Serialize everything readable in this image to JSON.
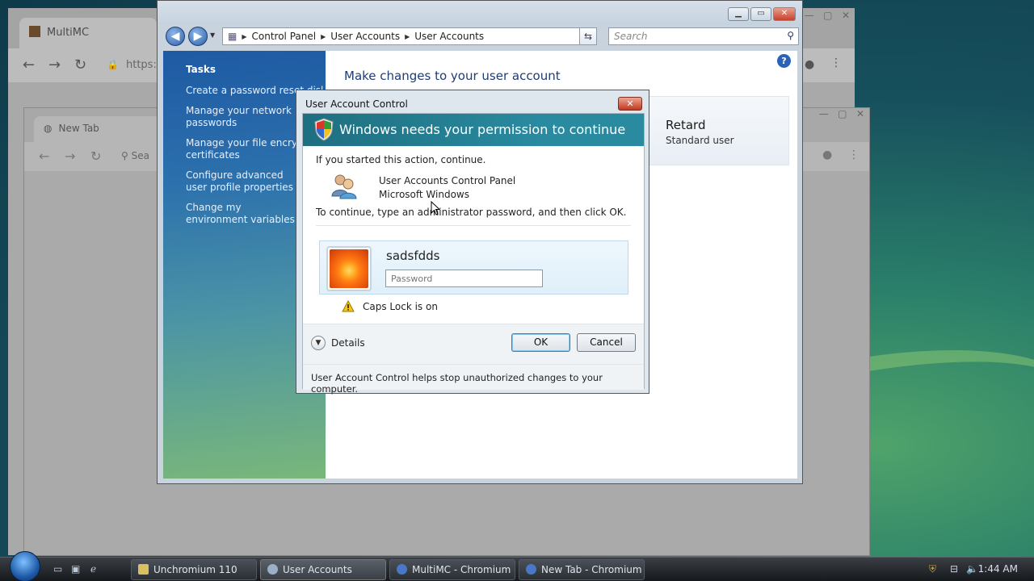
{
  "bg_window_1": {
    "tab_title": "MultiMC",
    "url_text": "https:/"
  },
  "bg_window_2": {
    "tab_title": "New Tab",
    "search_placeholder": "Sea"
  },
  "control_panel": {
    "breadcrumb": [
      "Control Panel",
      "User Accounts",
      "User Accounts"
    ],
    "search_placeholder": "Search",
    "tasks_heading": "Tasks",
    "tasks": [
      "Create a password reset disk",
      "Manage your network passwords",
      "Manage your file encryption certificates",
      "Configure advanced user profile properties",
      "Change my environment variables"
    ],
    "main_title": "Make changes to your user account",
    "user_name": "Retard",
    "user_role": "Standard user"
  },
  "uac": {
    "window_title": "User Account Control",
    "banner": "Windows needs your permission to continue",
    "intro": "If you started this action, continue.",
    "program_name": "User Accounts Control Panel",
    "publisher": "Microsoft Windows",
    "instruction": "To continue, type an administrator password, and then click OK.",
    "account_name": "sadsfdds",
    "password_placeholder": "Password",
    "caps_lock": "Caps Lock is on",
    "details": "Details",
    "ok": "OK",
    "cancel": "Cancel",
    "footer": "User Account Control helps stop unauthorized changes to your computer."
  },
  "taskbar": {
    "tasks": [
      "Unchromium 110",
      "User Accounts",
      "MultiMC - Chromium",
      "New Tab - Chromium"
    ],
    "clock": "1:44 AM"
  }
}
